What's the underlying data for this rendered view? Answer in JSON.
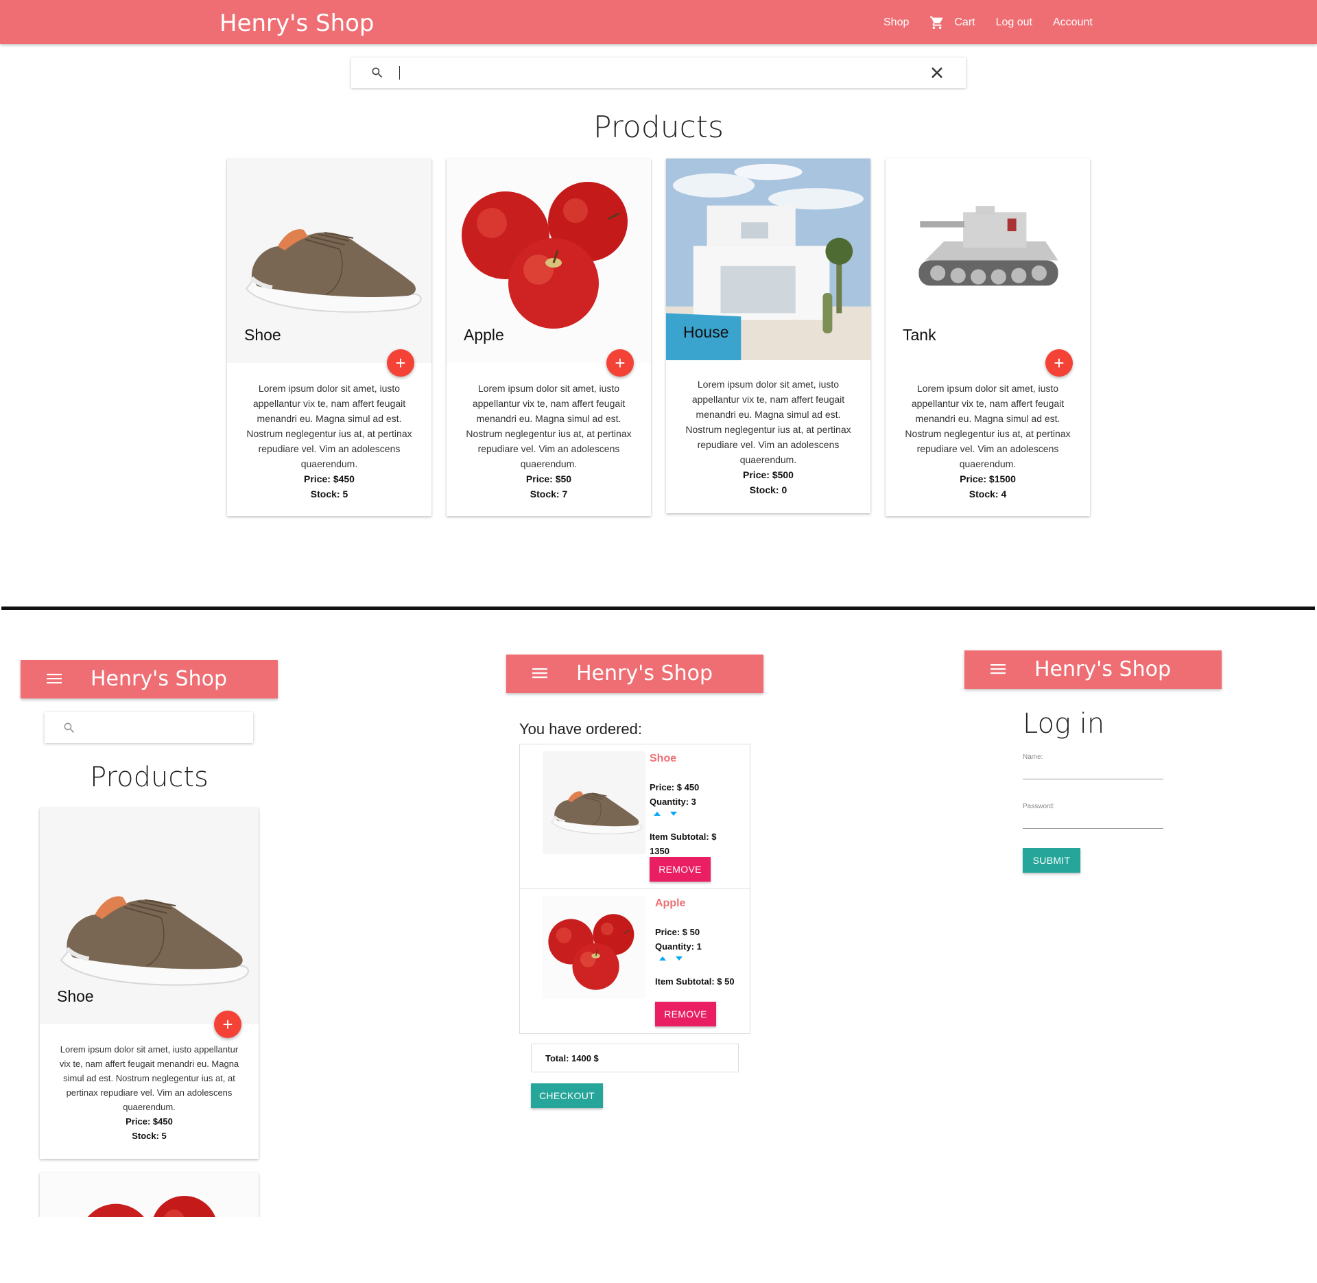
{
  "brand": "Henry's Shop",
  "nav": {
    "shop": "Shop",
    "cart": "Cart",
    "logout": "Log out",
    "account": "Account"
  },
  "products_title": "Products",
  "lorem": "Lorem ipsum dolor sit amet, iusto appellantur vix te, nam affert feugait menandri eu. Magna simul ad est. Nostrum neglegentur ius at, at pertinax repudiare vel. Vim an adolescens quaerendum.",
  "products": [
    {
      "name": "Shoe",
      "price": "Price: $450",
      "stock": "Stock: 5"
    },
    {
      "name": "Apple",
      "price": "Price: $50",
      "stock": "Stock: 7"
    },
    {
      "name": "House",
      "price": "Price: $500",
      "stock": "Stock: 0"
    },
    {
      "name": "Tank",
      "price": "Price: $1500",
      "stock": "Stock: 4"
    }
  ],
  "add_symbol": "+",
  "cart": {
    "heading": "You have ordered:",
    "items": [
      {
        "name": "Shoe",
        "price": "Price: $ 450",
        "quantity": "Quantity: 3",
        "subtotal": "Item Subtotal: $ 1350"
      },
      {
        "name": "Apple",
        "price": "Price: $ 50",
        "quantity": "Quantity: 1",
        "subtotal": "Item Subtotal: $ 50"
      }
    ],
    "remove_label": "REMOVE",
    "total": "Total: 1400 $",
    "checkout_label": "CHECKOUT"
  },
  "login": {
    "title": "Log in",
    "name_label": "Name:",
    "password_label": "Password:",
    "submit_label": "SUBMIT"
  },
  "colors": {
    "navbar": "#ee6e73",
    "fab": "#f44336",
    "remove": "#e91e63",
    "teal": "#26a69a",
    "arrows": "#03a9f4"
  },
  "icons": [
    "search-icon",
    "close-icon",
    "cart-icon",
    "menu-icon",
    "add-icon",
    "arrow-up-icon",
    "arrow-down-icon"
  ]
}
